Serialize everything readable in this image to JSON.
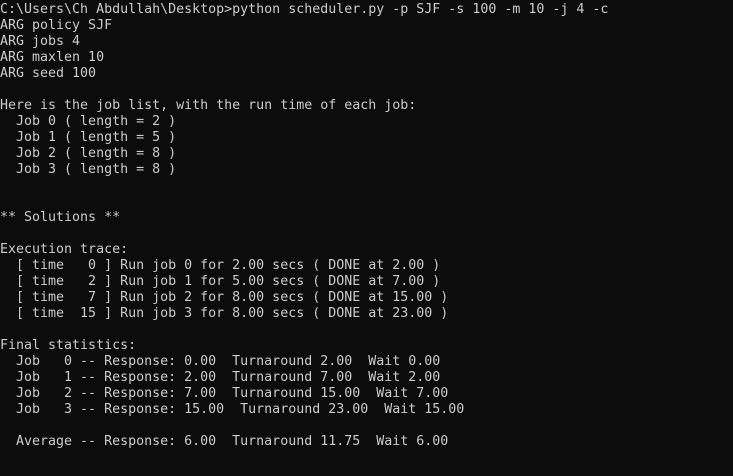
{
  "terminal": {
    "background": "#0c0c0c",
    "foreground": "#cccccc",
    "lines": [
      "C:\\Users\\Ch Abdullah\\Desktop>python scheduler.py -p SJF -s 100 -m 10 -j 4 -c",
      "ARG policy SJF",
      "ARG jobs 4",
      "ARG maxlen 10",
      "ARG seed 100",
      "",
      "Here is the job list, with the run time of each job:",
      "  Job 0 ( length = 2 )",
      "  Job 1 ( length = 5 )",
      "  Job 2 ( length = 8 )",
      "  Job 3 ( length = 8 )",
      "",
      "",
      "** Solutions **",
      "",
      "Execution trace:",
      "  [ time   0 ] Run job 0 for 2.00 secs ( DONE at 2.00 )",
      "  [ time   2 ] Run job 1 for 5.00 secs ( DONE at 7.00 )",
      "  [ time   7 ] Run job 2 for 8.00 secs ( DONE at 15.00 )",
      "  [ time  15 ] Run job 3 for 8.00 secs ( DONE at 23.00 )",
      "",
      "Final statistics:",
      "  Job   0 -- Response: 0.00  Turnaround 2.00  Wait 0.00",
      "  Job   1 -- Response: 2.00  Turnaround 7.00  Wait 2.00",
      "  Job   2 -- Response: 7.00  Turnaround 15.00  Wait 7.00",
      "  Job   3 -- Response: 15.00  Turnaround 23.00  Wait 15.00",
      "",
      "  Average -- Response: 6.00  Turnaround 11.75  Wait 6.00"
    ]
  }
}
